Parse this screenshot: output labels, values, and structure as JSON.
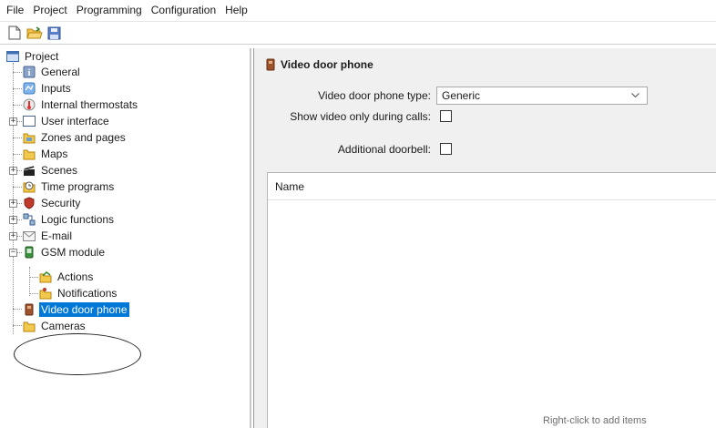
{
  "menubar": {
    "items": [
      "File",
      "Project",
      "Programming",
      "Configuration",
      "Help"
    ]
  },
  "toolbar": {
    "buttons": [
      "new-document-icon",
      "open-folder-icon",
      "save-disk-icon"
    ]
  },
  "tree": {
    "root": "Project",
    "items": [
      {
        "label": "General",
        "icon": "general-icon"
      },
      {
        "label": "Inputs",
        "icon": "inputs-icon"
      },
      {
        "label": "Internal thermostats",
        "icon": "thermostat-icon"
      },
      {
        "label": "User interface",
        "icon": "user-interface-icon"
      },
      {
        "label": "Zones and pages",
        "icon": "zones-icon"
      },
      {
        "label": "Maps",
        "icon": "maps-icon"
      },
      {
        "label": "Scenes",
        "icon": "scenes-icon"
      },
      {
        "label": "Time programs",
        "icon": "clock-icon"
      },
      {
        "label": "Security",
        "icon": "security-icon"
      },
      {
        "label": "Logic functions",
        "icon": "logic-icon"
      },
      {
        "label": "E-mail",
        "icon": "email-icon"
      },
      {
        "label": "GSM module",
        "icon": "gsm-icon"
      },
      {
        "label": "Actions",
        "icon": "actions-icon"
      },
      {
        "label": "Notifications",
        "icon": "notifications-icon"
      },
      {
        "label": "Video door phone",
        "icon": "door-phone-icon"
      },
      {
        "label": "Cameras",
        "icon": "camera-folder-icon"
      }
    ]
  },
  "panel": {
    "title": "Video door phone",
    "type_label": "Video door phone type:",
    "type_value": "Generic",
    "video_calls_label": "Show video only during calls:",
    "doorbell_label": "Additional doorbell:",
    "list_header": "Name",
    "list_hint": "Right-click to add items"
  },
  "colors": {
    "selection": "#0078d7",
    "panel_bg": "#f0f0f0"
  }
}
